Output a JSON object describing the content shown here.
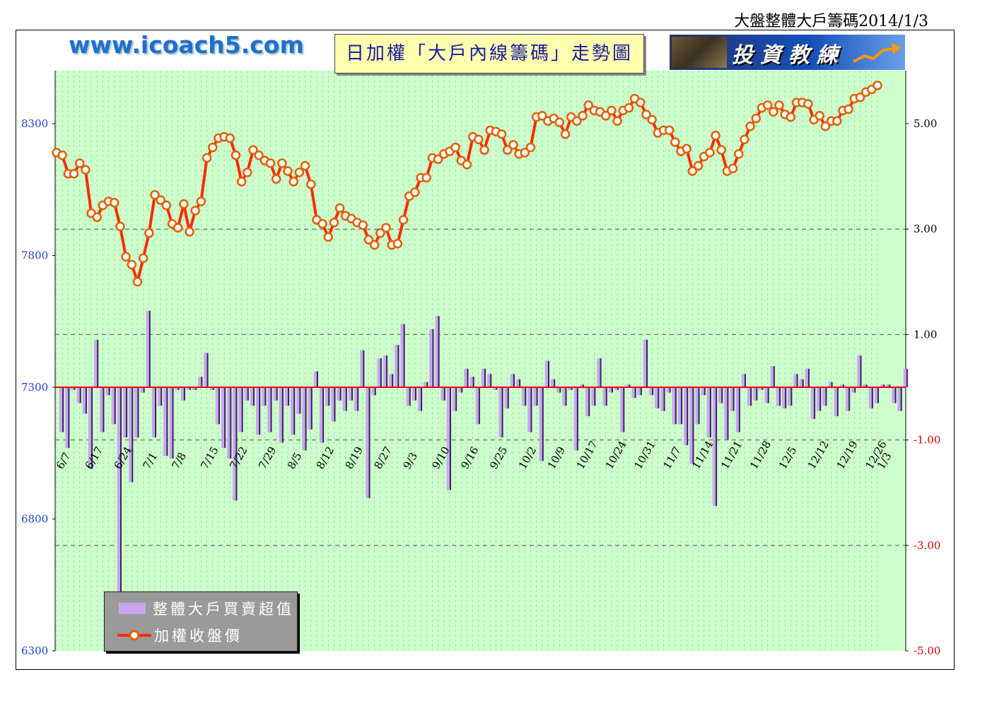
{
  "header": {
    "top_title": "大盤整體大戶籌碼2014/1/3",
    "site_url": "www.icoach5.com",
    "chart_title": "日加權「大戶內線籌碼」走勢圖",
    "logo_text": "投資教練"
  },
  "legend": {
    "bar_label": "整體大戶買賣超值",
    "line_label": "加權收盤價"
  },
  "colors": {
    "plot_bg": "#ccffcc",
    "bar": "#c9a6ee",
    "bar_shadow": "#3a2060",
    "line": "#ff2a00",
    "marker_fill": "#ffffff",
    "marker_edge": "#e06000",
    "zero_line": "#ff0000",
    "left_axis_text": "#1f3fbf",
    "right_axis_text": "#000000"
  },
  "chart_data": {
    "type": "bar+line",
    "left_axis": {
      "ylim": [
        6300,
        8300
      ],
      "ticks": [
        "8300",
        "7800",
        "7300",
        "6800",
        "6300"
      ]
    },
    "right_axis": {
      "ylim": [
        -5,
        5
      ],
      "ticks": [
        "5.00",
        "3.00",
        "1.00",
        "-1.00",
        "-3.00",
        "-5.00"
      ]
    },
    "x_tick_labels": [
      "6/7",
      "6/17",
      "6/24",
      "7/1",
      "7/8",
      "7/15",
      "7/22",
      "7/29",
      "8/5",
      "8/12",
      "8/19",
      "8/27",
      "9/3",
      "9/10",
      "9/16",
      "9/25",
      "10/2",
      "10/9",
      "10/17",
      "10/24",
      "10/31",
      "11/7",
      "11/14",
      "11/21",
      "11/28",
      "12/5",
      "12/12",
      "12/19",
      "12/26",
      "1/3"
    ],
    "grid": "dashed, every 5 trading days",
    "series": [
      {
        "name": "整體大戶買賣超值",
        "type": "bar",
        "axis": "right",
        "values": [
          -0.85,
          -1.15,
          -0.05,
          -0.3,
          -0.5,
          -1.55,
          0.9,
          -0.85,
          -0.15,
          -0.7,
          -4.3,
          -0.95,
          -1.8,
          -0.95,
          -0.1,
          1.45,
          -0.95,
          -0.35,
          -1.3,
          -1.35,
          -0.05,
          -0.25,
          -0.05,
          -0.05,
          0.2,
          0.65,
          -0.05,
          -0.7,
          -1.15,
          -1.35,
          -2.15,
          -0.85,
          -0.25,
          -0.35,
          -0.9,
          -0.35,
          -0.85,
          -0.25,
          -1.05,
          -0.35,
          -0.9,
          -0.5,
          -1.2,
          -0.8,
          0.3,
          -1.05,
          -0.35,
          -0.65,
          -0.25,
          -0.45,
          -0.25,
          -0.45,
          0.7,
          -2.1,
          -0.15,
          0.55,
          0.6,
          0.25,
          0.8,
          1.2,
          -0.35,
          -0.25,
          -0.45,
          0.1,
          1.1,
          1.35,
          -0.25,
          -1.95,
          -0.45,
          -0.1,
          0.35,
          0.2,
          -0.7,
          0.35,
          0.25,
          -0.05,
          -0.95,
          -0.4,
          0.25,
          0.15,
          -0.35,
          -0.85,
          -0.35,
          -1.4,
          0.5,
          0.15,
          -0.1,
          -0.35,
          -0.05,
          -1.2,
          0.05,
          -0.55,
          -0.35,
          0.55,
          -0.35,
          -0.1,
          -0.05,
          -0.85,
          0.05,
          -0.2,
          -0.15,
          0.9,
          -0.15,
          -0.4,
          -0.45,
          -0.1,
          -0.7,
          -0.7,
          -1.1,
          -1.45,
          -0.7,
          -0.15,
          -0.95,
          -2.25,
          -0.3,
          -1.0,
          -0.45,
          -0.85,
          0.25,
          -0.35,
          -0.25,
          -0.05,
          -0.3,
          0.4,
          -0.35,
          -0.4,
          -0.35,
          0.25,
          0.15,
          0.35,
          -0.6,
          -0.45,
          -0.35,
          0.1,
          -0.55,
          0.05,
          -0.45,
          -0.1,
          0.6,
          0.05,
          -0.4,
          -0.3,
          0.05,
          0.05,
          -0.3,
          -0.45,
          0.35
        ]
      },
      {
        "name": "加權收盤價",
        "type": "line",
        "axis": "left",
        "values": [
          8190,
          8180,
          8110,
          8110,
          8150,
          8125,
          7960,
          7945,
          7990,
          8005,
          8000,
          7910,
          7795,
          7765,
          7700,
          7790,
          7885,
          8030,
          8010,
          7990,
          7920,
          7905,
          7995,
          7890,
          7970,
          8005,
          8170,
          8210,
          8245,
          8250,
          8245,
          8180,
          8080,
          8115,
          8200,
          8180,
          8160,
          8150,
          8090,
          8150,
          8120,
          8080,
          8115,
          8140,
          8070,
          7935,
          7920,
          7870,
          7925,
          7980,
          7950,
          7940,
          7925,
          7915,
          7860,
          7840,
          7885,
          7905,
          7840,
          7845,
          7935,
          8025,
          8040,
          8095,
          8095,
          8170,
          8165,
          8185,
          8195,
          8210,
          8160,
          8145,
          8250,
          8240,
          8200,
          8275,
          8270,
          8260,
          8200,
          8220,
          8185,
          8190,
          8210,
          8325,
          8330,
          8310,
          8320,
          8305,
          8260,
          8325,
          8310,
          8330,
          8370,
          8350,
          8345,
          8330,
          8350,
          8310,
          8350,
          8360,
          8395,
          8380,
          8335,
          8315,
          8265,
          8275,
          8275,
          8230,
          8195,
          8205,
          8120,
          8140,
          8175,
          8190,
          8255,
          8200,
          8120,
          8130,
          8185,
          8240,
          8290,
          8320,
          8360,
          8370,
          8345,
          8370,
          8335,
          8325,
          8380,
          8380,
          8375,
          8315,
          8330,
          8290,
          8310,
          8310,
          8350,
          8355,
          8395,
          8400,
          8420,
          8430,
          8445
        ]
      }
    ]
  }
}
